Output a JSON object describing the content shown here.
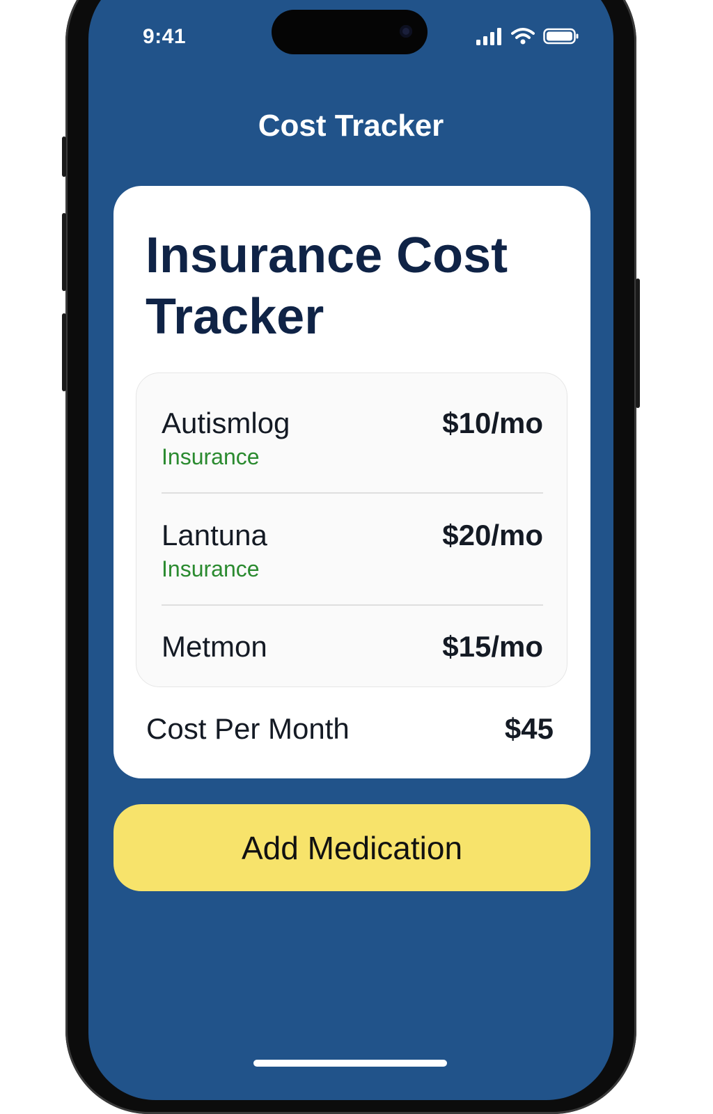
{
  "status_bar": {
    "time": "9:41",
    "icons": [
      "signal-icon",
      "wifi-icon",
      "battery-icon"
    ]
  },
  "header": {
    "title": "Cost Tracker"
  },
  "card": {
    "title": "Insurance Cost Tracker",
    "items": [
      {
        "name": "Autismlog",
        "subtitle": "Insurance",
        "price": "$10/mo"
      },
      {
        "name": "Lantuna",
        "subtitle": "Insurance",
        "price": "$20/mo"
      },
      {
        "name": "Metmon",
        "subtitle": "",
        "price": "$15/mo"
      }
    ],
    "total_label": "Cost Per Month",
    "total_value": "$45"
  },
  "actions": {
    "add_label": "Add Medication"
  },
  "colors": {
    "background": "#21538a",
    "card": "#ffffff",
    "accent_button": "#f7e36b",
    "subtitle_green": "#2a8a2f",
    "title_navy": "#0f2346"
  }
}
